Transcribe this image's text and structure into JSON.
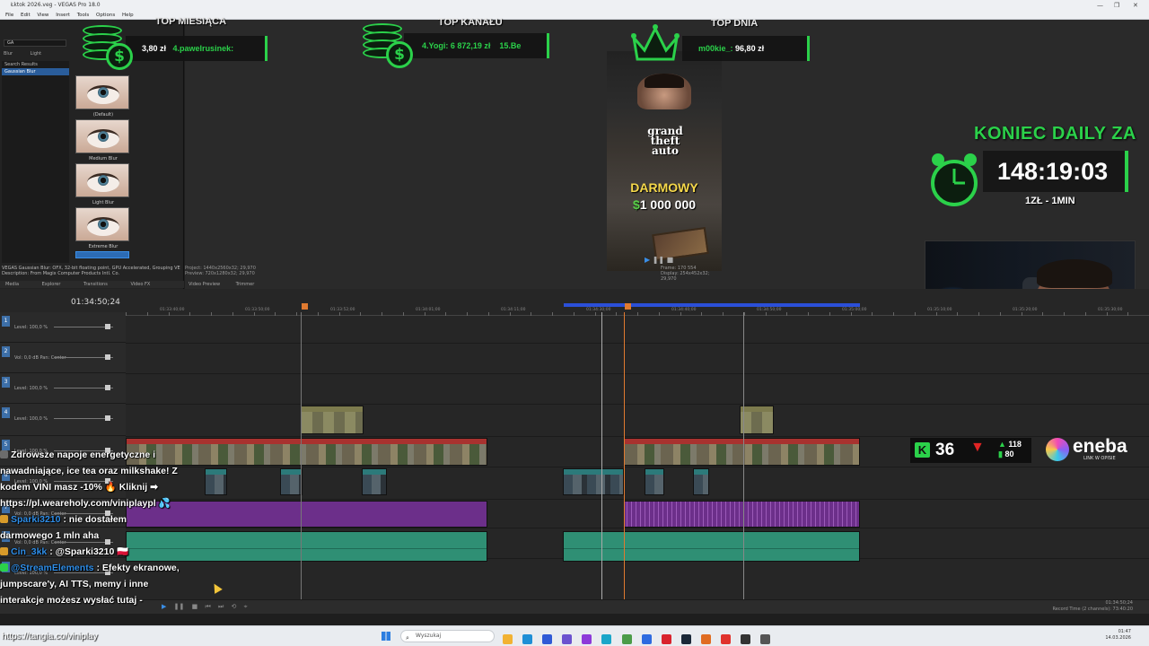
{
  "window": {
    "title": "Łktok 2026.veg - VEGAS Pro 18.0",
    "menu": [
      "File",
      "Edit",
      "View",
      "Insert",
      "Tools",
      "Options",
      "Help"
    ]
  },
  "fx_panel": {
    "search_value": "GA",
    "tabs": [
      "Blur",
      "Light"
    ],
    "list_header": "Search Results",
    "selected_item": "Gaussian Blur",
    "presets": [
      "(Default)",
      "Medium Blur",
      "Light Blur",
      "Extreme Blur"
    ],
    "description_1": "VEGAS Gaussian Blur: OFX, 32-bit floating point, GPU Accelerated, Grouping VE",
    "description_2": "Description: From Magix Computer Products Intl. Co.",
    "bottom_tabs": [
      "Media",
      "Explorer",
      "Transitions",
      "Video FX"
    ]
  },
  "preview": {
    "project_line": "Project: 1440x2560x32; 29,970",
    "preview_line": "Preview: 720x1280x32; 29,970",
    "frame_line": "Frame: 170 554",
    "display_line": "Display: 254x452x32; 29,970",
    "tabs": [
      "Video Preview",
      "Trimmer"
    ],
    "video_gta": "grand theft auto",
    "video_darmowy": "DARMOWY",
    "video_amount": "1 000 000",
    "video_currency": "$"
  },
  "overlays": {
    "top_month_title": "TOP MIESIĄCA",
    "top_month_value": "3,80 zł",
    "top_month_user": "4.pawelrusinek:",
    "top_channel_title": "TOP KANAŁU",
    "top_channel_entry": "4.Yogi: 6 872,19 zł",
    "top_channel_next": "15.Be",
    "top_day_title": "TOP DNIA",
    "top_day_user": "m00kie_:",
    "top_day_value": "96,80 zł",
    "timer_label": "KONIEC DAILY ZA",
    "timer_value": "148:19:03",
    "timer_rate": "1ZŁ - 1MIN",
    "kick_viewers": "36",
    "kick_stat_1": "118",
    "kick_stat_2": "80",
    "sponsor_name": "eneba",
    "sponsor_sub": "LINK W OPISIE"
  },
  "timeline": {
    "timecode": "01:34:50;24",
    "ruler_ticks": [
      "01:33:40;00",
      "01:33:50;00",
      "01:33:52;00",
      "01:34:01;00",
      "01:34:11;00",
      "01:34:30;00",
      "01:34:40;00",
      "01:34:50;00",
      "01:35:00;00",
      "01:35:10;00",
      "01:35:20;00",
      "01:35:30;00"
    ],
    "tracks": [
      {
        "num": "1",
        "level": "Level: 100,0 %"
      },
      {
        "num": "2",
        "level": "Vol: 0,0 dB",
        "pan": "Pan: Center"
      },
      {
        "num": "3",
        "level": "Level: 100,0 %"
      },
      {
        "num": "4",
        "level": "Level: 100,0 %"
      },
      {
        "num": "5",
        "level": "Level: 100,0 %"
      },
      {
        "num": "6",
        "level": "Level: 100,0 %"
      },
      {
        "num": "7",
        "level": "Vol: 0,0 dB",
        "pan": "Pan: Center"
      },
      {
        "num": "8",
        "level": "Vol: 0,0 dB",
        "pan": "Pan: Center"
      },
      {
        "num": "9",
        "level": "Level: 100,0 %"
      }
    ],
    "record_time": "Record Time (2 channels): 73:40:20",
    "end_timecode": "01:34:50;24"
  },
  "chat": [
    {
      "user": "",
      "text": "Zdrowsze napoje energetyczne i"
    },
    {
      "user": "",
      "text": "nawadniające, ice tea oraz milkshake! Z"
    },
    {
      "user": "",
      "text": "kodem VINI masz -10% 🔥 Kliknij ➡"
    },
    {
      "user": "",
      "text": "https://pl.weareholy.com/viniplaypl 💦"
    },
    {
      "user": "Sparki3210",
      "text": ": nie dostałem"
    },
    {
      "user": "",
      "text": "darmowego 1 mln aha"
    },
    {
      "user": "Cin_3kk",
      "text": ": @Sparki3210 🇵🇱"
    },
    {
      "user": "@StreamElements",
      "text": ": Efekty ekranowe,"
    },
    {
      "user": "",
      "text": "jumpscare'y, AI TTS, memy i inne"
    },
    {
      "user": "",
      "text": "interakcje możesz wysłać tutaj -"
    }
  ],
  "chat_link": "https://tangia.co/viniplay",
  "taskbar": {
    "search_placeholder": "Wyszukaj",
    "time": "01:47",
    "date": "14.03.2026"
  },
  "colors": {
    "accent_green": "#2bd14a",
    "vegas_blue": "#3a8ee6",
    "clip_red": "#a8322f",
    "audio_purple": "#6c2f8a",
    "audio_teal": "#2f8f74"
  }
}
